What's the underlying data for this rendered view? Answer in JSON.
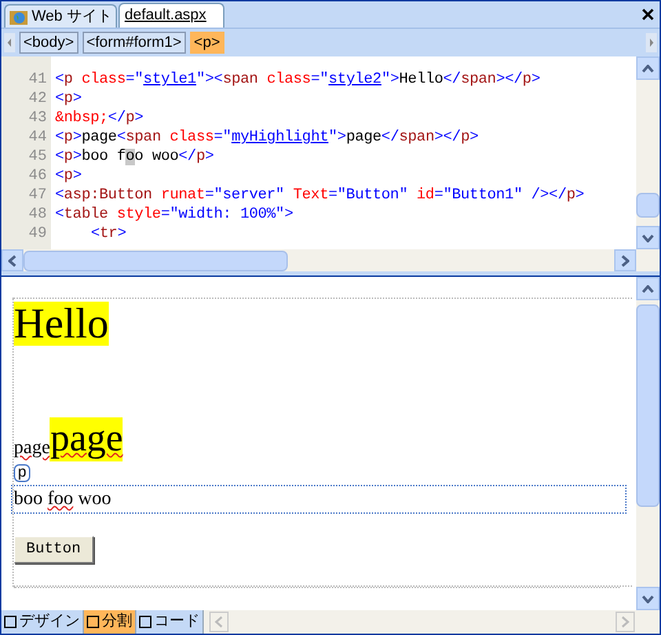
{
  "tabs": [
    {
      "label": "Web サイト",
      "selected": false
    },
    {
      "label": "default.aspx",
      "selected": true
    }
  ],
  "breadcrumbs": [
    {
      "label": "<body>",
      "selected": false
    },
    {
      "label": "<form#form1>",
      "selected": false
    },
    {
      "label": "<p>",
      "selected": true
    }
  ],
  "code_lines": [
    {
      "number": "41",
      "tokens": [
        {
          "kind": "punct",
          "text": "<"
        },
        {
          "kind": "element",
          "text": "p"
        },
        {
          "kind": "attr",
          "text": " class"
        },
        {
          "kind": "punct",
          "text": "=\""
        },
        {
          "kind": "link",
          "text": "style1"
        },
        {
          "kind": "punct",
          "text": "\"><"
        },
        {
          "kind": "element",
          "text": "span"
        },
        {
          "kind": "attr",
          "text": " class"
        },
        {
          "kind": "punct",
          "text": "=\""
        },
        {
          "kind": "link",
          "text": "style2"
        },
        {
          "kind": "punct",
          "text": "\">"
        },
        {
          "kind": "text",
          "text": "Hello"
        },
        {
          "kind": "punct",
          "text": "</"
        },
        {
          "kind": "element",
          "text": "span"
        },
        {
          "kind": "punct",
          "text": "></"
        },
        {
          "kind": "element",
          "text": "p"
        },
        {
          "kind": "punct",
          "text": ">"
        }
      ]
    },
    {
      "number": "42",
      "tokens": [
        {
          "kind": "punct",
          "text": "<"
        },
        {
          "kind": "element",
          "text": "p"
        },
        {
          "kind": "punct",
          "text": ">"
        }
      ]
    },
    {
      "number": "43",
      "tokens": [
        {
          "kind": "entity",
          "text": "&nbsp;"
        },
        {
          "kind": "punct",
          "text": "</"
        },
        {
          "kind": "element",
          "text": "p"
        },
        {
          "kind": "punct",
          "text": ">"
        }
      ]
    },
    {
      "number": "44",
      "tokens": [
        {
          "kind": "punct",
          "text": "<"
        },
        {
          "kind": "element",
          "text": "p"
        },
        {
          "kind": "punct",
          "text": ">"
        },
        {
          "kind": "text",
          "text": "page"
        },
        {
          "kind": "punct",
          "text": "<"
        },
        {
          "kind": "element",
          "text": "span"
        },
        {
          "kind": "attr",
          "text": " class"
        },
        {
          "kind": "punct",
          "text": "=\""
        },
        {
          "kind": "link",
          "text": "myHighlight"
        },
        {
          "kind": "punct",
          "text": "\">"
        },
        {
          "kind": "text",
          "text": "page"
        },
        {
          "kind": "punct",
          "text": "</"
        },
        {
          "kind": "element",
          "text": "span"
        },
        {
          "kind": "punct",
          "text": "></"
        },
        {
          "kind": "element",
          "text": "p"
        },
        {
          "kind": "punct",
          "text": ">"
        }
      ]
    },
    {
      "number": "45",
      "tokens": [
        {
          "kind": "punct",
          "text": "<"
        },
        {
          "kind": "element",
          "text": "p"
        },
        {
          "kind": "punct",
          "text": ">"
        },
        {
          "kind": "text",
          "text": "boo f"
        },
        {
          "kind": "cursor",
          "text": "o"
        },
        {
          "kind": "text",
          "text": "o woo"
        },
        {
          "kind": "punct",
          "text": "</"
        },
        {
          "kind": "element",
          "text": "p"
        },
        {
          "kind": "punct",
          "text": ">"
        }
      ]
    },
    {
      "number": "46",
      "tokens": [
        {
          "kind": "punct",
          "text": "<"
        },
        {
          "kind": "element",
          "text": "p"
        },
        {
          "kind": "punct",
          "text": ">"
        }
      ]
    },
    {
      "number": "47",
      "tokens": [
        {
          "kind": "punct",
          "text": "<"
        },
        {
          "kind": "element",
          "text": "asp:Button"
        },
        {
          "kind": "attr",
          "text": " runat"
        },
        {
          "kind": "value",
          "text": "=\"server\""
        },
        {
          "kind": "attr",
          "text": " Text"
        },
        {
          "kind": "value",
          "text": "=\"Button\""
        },
        {
          "kind": "attr",
          "text": " id"
        },
        {
          "kind": "value",
          "text": "=\"Button1\""
        },
        {
          "kind": "punct",
          "text": " /></"
        },
        {
          "kind": "element",
          "text": "p"
        },
        {
          "kind": "punct",
          "text": ">"
        }
      ]
    },
    {
      "number": "48",
      "tokens": [
        {
          "kind": "punct",
          "text": "<"
        },
        {
          "kind": "element",
          "text": "table"
        },
        {
          "kind": "attr",
          "text": " style"
        },
        {
          "kind": "value",
          "text": "=\"width: 100%\""
        },
        {
          "kind": "punct",
          "text": ">"
        }
      ]
    },
    {
      "number": "49",
      "indented": true,
      "tokens": [
        {
          "kind": "punct",
          "text": "<"
        },
        {
          "kind": "element",
          "text": "tr"
        },
        {
          "kind": "punct",
          "text": ">"
        }
      ]
    }
  ],
  "design": {
    "heading": "Hello",
    "page_line": [
      {
        "text": "page",
        "highlighted": false,
        "misspelled": true
      },
      {
        "text": "page",
        "highlighted": true,
        "misspelled": true
      }
    ],
    "tag_label": "p",
    "selected_paragraph": [
      {
        "text": "boo ",
        "misspelled": false
      },
      {
        "text": "foo",
        "misspelled": true
      },
      {
        "text": " woo",
        "misspelled": false
      }
    ],
    "button": "Button"
  },
  "view_tabs": [
    {
      "label": "デザイン",
      "selected": false
    },
    {
      "label": "分割",
      "selected": true
    },
    {
      "label": "コード",
      "selected": false
    }
  ]
}
